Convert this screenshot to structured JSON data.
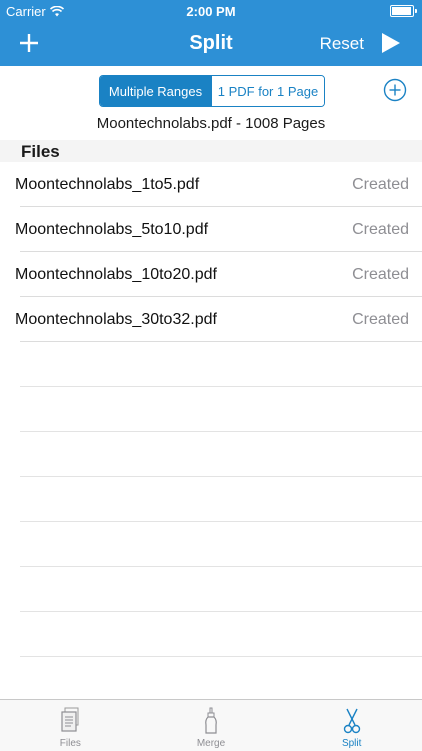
{
  "status_bar": {
    "carrier": "Carrier",
    "time": "2:00 PM",
    "battery_level": 1.0
  },
  "navbar": {
    "title": "Split",
    "left_icon": "plus-icon",
    "reset_label": "Reset",
    "right_icon": "play-icon"
  },
  "segmented": {
    "options": [
      "Multiple Ranges",
      "1 PDF for 1 Page"
    ],
    "selected": "Multiple Ranges"
  },
  "add_icon": "add-circle-icon",
  "document": {
    "info": "Moontechnolabs.pdf - 1008 Pages"
  },
  "files_section": {
    "header": "Files",
    "items": [
      {
        "name": "Moontechnolabs_1to5.pdf",
        "status": "Created"
      },
      {
        "name": "Moontechnolabs_5to10.pdf",
        "status": "Created"
      },
      {
        "name": "Moontechnolabs_10to20.pdf",
        "status": "Created"
      },
      {
        "name": "Moontechnolabs_30to32.pdf",
        "status": "Created"
      }
    ]
  },
  "tab_bar": {
    "tabs": [
      {
        "label": "Files",
        "icon": "document-icon"
      },
      {
        "label": "Merge",
        "icon": "glue-icon"
      },
      {
        "label": "Split",
        "icon": "scissors-icon"
      }
    ],
    "active": "Split"
  },
  "colors": {
    "nav_background": "#2d90d6",
    "accent": "#1a82c4",
    "status_gray": "#8e8e93"
  }
}
